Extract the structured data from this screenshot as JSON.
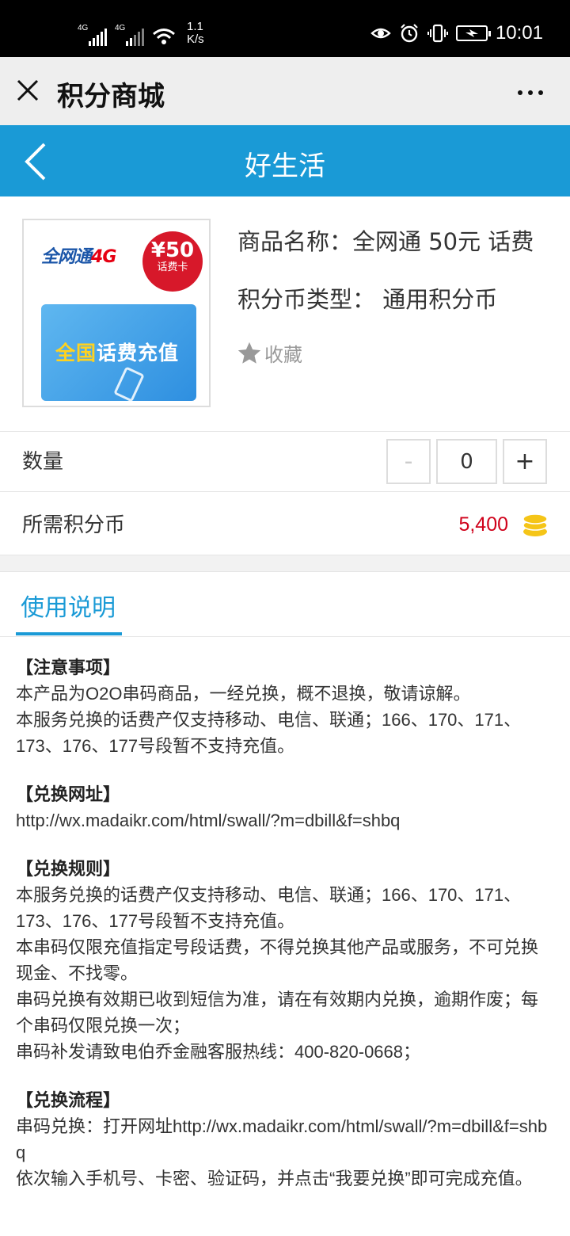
{
  "status_bar": {
    "net1": "4G",
    "net2": "4G",
    "speed_value": "1.1",
    "speed_unit": "K/s",
    "time": "10:01"
  },
  "titlebar": {
    "title": "积分商城"
  },
  "header": {
    "title": "好生活"
  },
  "product": {
    "image": {
      "brand": "全网通",
      "brand_4g": "4G",
      "badge_amount": "¥50",
      "badge_sub": "话费卡",
      "card_text_hl": "全国",
      "card_text": "话费充值"
    },
    "name": "商品名称：全网通 50元 话费",
    "coin_type": "积分币类型：  通用积分币",
    "favorite_label": "收藏"
  },
  "quantity": {
    "label": "数量",
    "minus": "-",
    "value": "0",
    "plus": "+"
  },
  "points": {
    "label": "所需积分币",
    "value": "5,400"
  },
  "tab": {
    "label": "使用说明"
  },
  "notes": {
    "s1_title": "【注意事项】",
    "s1_l1": "本产品为O2O串码商品，一经兑换，概不退换，敬请谅解。",
    "s1_l2": "本服务兑换的话费产仅支持移动、电信、联通；166、170、171、173、176、177号段暂不支持充值。",
    "s2_title": "【兑换网址】",
    "s2_l1": "http://wx.madaikr.com/html/swall/?m=dbill&f=shbq",
    "s3_title": "【兑换规则】",
    "s3_l1": "本服务兑换的话费产仅支持移动、电信、联通；166、170、171、173、176、177号段暂不支持充值。",
    "s3_l2": "本串码仅限充值指定号段话费，不得兑换其他产品或服务，不可兑换现金、不找零。",
    "s3_l3": "串码兑换有效期已收到短信为准，请在有效期内兑换，逾期作废；每个串码仅限兑换一次；",
    "s3_l4": "串码补发请致电伯乔金融客服热线：400-820-0668；",
    "s4_title": "【兑换流程】",
    "s4_l1": "串码兑换：打开网址http://wx.madaikr.com/html/swall/?m=dbill&f=shbq",
    "s4_l2": "依次输入手机号、卡密、验证码，并点击“我要兑换”即可完成充值。"
  },
  "colors": {
    "accent": "#1a9ad6",
    "price": "#d0021b",
    "coin": "#f5c518"
  }
}
